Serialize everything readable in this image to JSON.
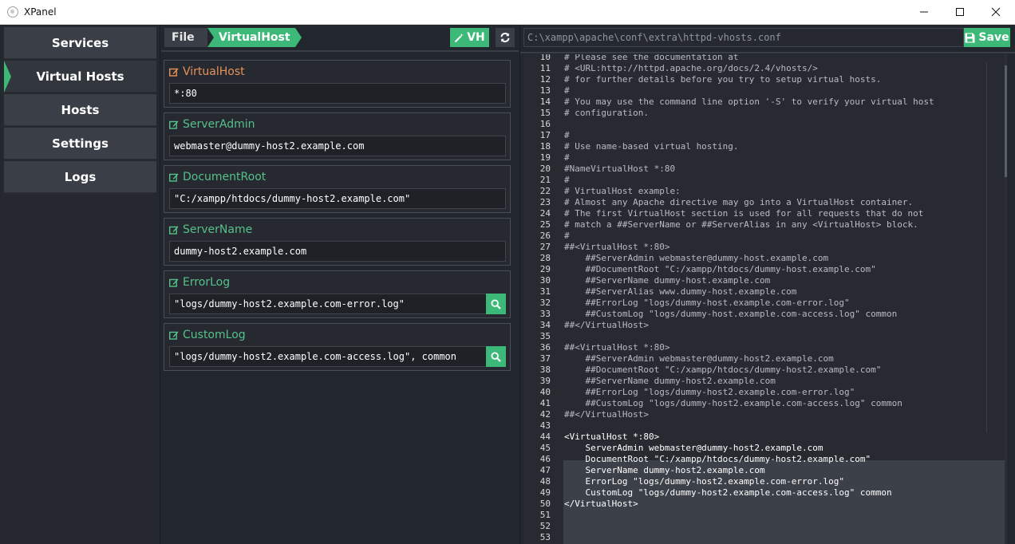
{
  "window": {
    "title": "XPanel"
  },
  "sidebar": {
    "items": [
      {
        "label": "Services",
        "active": false
      },
      {
        "label": "Virtual Hosts",
        "active": true
      },
      {
        "label": "Hosts",
        "active": false
      },
      {
        "label": "Settings",
        "active": false
      },
      {
        "label": "Logs",
        "active": false
      }
    ]
  },
  "breadcrumb": {
    "file": "File",
    "current": "VirtualHost"
  },
  "toolbar": {
    "vh_label": "VH"
  },
  "fields": [
    {
      "label": "VirtualHost",
      "value": "*:80",
      "search": false
    },
    {
      "label": "ServerAdmin",
      "value": "webmaster@dummy-host2.example.com",
      "search": false
    },
    {
      "label": "DocumentRoot",
      "value": "\"C:/xampp/htdocs/dummy-host2.example.com\"",
      "search": false
    },
    {
      "label": "ServerName",
      "value": "dummy-host2.example.com",
      "search": false
    },
    {
      "label": "ErrorLog",
      "value": "\"logs/dummy-host2.example.com-error.log\"",
      "search": true
    },
    {
      "label": "CustomLog",
      "value": "\"logs/dummy-host2.example.com-access.log\", common",
      "search": true
    }
  ],
  "editor": {
    "path": "C:\\xampp\\apache\\conf\\extra\\httpd-vhosts.conf",
    "save_label": "Save",
    "lines": [
      {
        "n": "10",
        "t": "# Please see the documentation at"
      },
      {
        "n": "11",
        "t": "# <URL:http://httpd.apache.org/docs/2.4/vhosts/>"
      },
      {
        "n": "12",
        "t": "# for further details before you try to setup virtual hosts."
      },
      {
        "n": "13",
        "t": "#"
      },
      {
        "n": "14",
        "t": "# You may use the command line option '-S' to verify your virtual host"
      },
      {
        "n": "15",
        "t": "# configuration."
      },
      {
        "n": "16",
        "t": ""
      },
      {
        "n": "17",
        "t": "#"
      },
      {
        "n": "18",
        "t": "# Use name-based virtual hosting."
      },
      {
        "n": "19",
        "t": "#"
      },
      {
        "n": "20",
        "t": "#NameVirtualHost *:80"
      },
      {
        "n": "21",
        "t": "#"
      },
      {
        "n": "22",
        "t": "# VirtualHost example:"
      },
      {
        "n": "23",
        "t": "# Almost any Apache directive may go into a VirtualHost container."
      },
      {
        "n": "24",
        "t": "# The first VirtualHost section is used for all requests that do not"
      },
      {
        "n": "25",
        "t": "# match a ##ServerName or ##ServerAlias in any <VirtualHost> block."
      },
      {
        "n": "26",
        "t": "#"
      },
      {
        "n": "27",
        "t": "##<VirtualHost *:80>"
      },
      {
        "n": "28",
        "t": "    ##ServerAdmin webmaster@dummy-host.example.com"
      },
      {
        "n": "29",
        "t": "    ##DocumentRoot \"C:/xampp/htdocs/dummy-host.example.com\""
      },
      {
        "n": "30",
        "t": "    ##ServerName dummy-host.example.com"
      },
      {
        "n": "31",
        "t": "    ##ServerAlias www.dummy-host.example.com"
      },
      {
        "n": "32",
        "t": "    ##ErrorLog \"logs/dummy-host.example.com-error.log\""
      },
      {
        "n": "33",
        "t": "    ##CustomLog \"logs/dummy-host.example.com-access.log\" common"
      },
      {
        "n": "34",
        "t": "##</VirtualHost>"
      },
      {
        "n": "35",
        "t": ""
      },
      {
        "n": "36",
        "t": "##<VirtualHost *:80>"
      },
      {
        "n": "37",
        "t": "    ##ServerAdmin webmaster@dummy-host2.example.com"
      },
      {
        "n": "38",
        "t": "    ##DocumentRoot \"C:/xampp/htdocs/dummy-host2.example.com\""
      },
      {
        "n": "39",
        "t": "    ##ServerName dummy-host2.example.com"
      },
      {
        "n": "40",
        "t": "    ##ErrorLog \"logs/dummy-host2.example.com-error.log\""
      },
      {
        "n": "41",
        "t": "    ##CustomLog \"logs/dummy-host2.example.com-access.log\" common"
      },
      {
        "n": "42",
        "t": "##</VirtualHost>"
      },
      {
        "n": "43",
        "t": ""
      },
      {
        "n": "44",
        "t": "<VirtualHost *:80>"
      },
      {
        "n": "45",
        "t": "    ServerAdmin webmaster@dummy-host2.example.com"
      },
      {
        "n": "46",
        "t": "    DocumentRoot \"C:/xampp/htdocs/dummy-host2.example.com\""
      },
      {
        "n": "47",
        "t": "    ServerName dummy-host2.example.com"
      },
      {
        "n": "48",
        "t": "    ErrorLog \"logs/dummy-host2.example.com-error.log\""
      },
      {
        "n": "49",
        "t": "    CustomLog \"logs/dummy-host2.example.com-access.log\" common"
      },
      {
        "n": "50",
        "t": "</VirtualHost>"
      },
      {
        "n": "51",
        "t": ""
      },
      {
        "n": "52",
        "t": ""
      },
      {
        "n": "53",
        "t": ""
      }
    ]
  },
  "colors": {
    "accent": "#3cb878",
    "label_orange": "#e8915a",
    "label_green": "#56c08a"
  }
}
